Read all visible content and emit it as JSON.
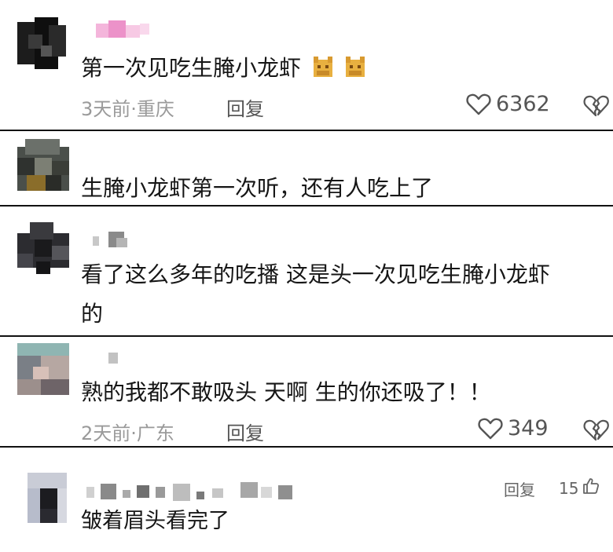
{
  "comments": [
    {
      "text": "第一次见吃生腌小龙虾",
      "emoji_icon": "cat-face-icon",
      "date": "3天前",
      "location": "重庆",
      "reply_label": "回复",
      "likes": "6362"
    },
    {
      "text": "生腌小龙虾第一次听，还有人吃上了"
    },
    {
      "text_line1": "看了这么多年的吃播 这是头一次见吃生腌小龙虾",
      "text_line2": "的"
    },
    {
      "text": "熟的我都不敢吸头  天啊 生的你还吸了！！",
      "date": "2天前",
      "location": "广东",
      "reply_label": "回复",
      "likes": "349"
    },
    {
      "text": "皱着眉头看完了",
      "reply_label": "回复",
      "likes": "15"
    }
  ],
  "separator": "·",
  "icons": {
    "like": "heart-outline-icon",
    "dislike": "broken-heart-icon",
    "thumb": "thumbs-up-icon"
  },
  "colors": {
    "meta_gray": "#9a9a9a",
    "divider": "#111111",
    "username_pink": "#f2a6d2"
  }
}
